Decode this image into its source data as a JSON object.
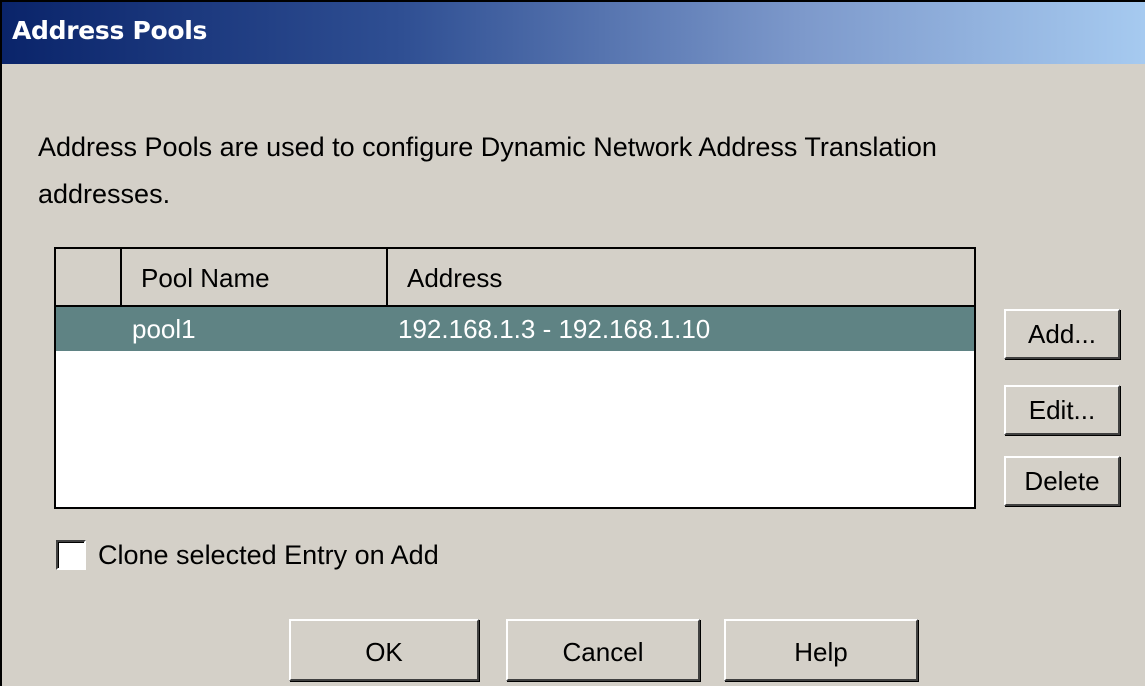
{
  "window": {
    "title": "Address Pools"
  },
  "description": {
    "line1": "Address Pools are used to configure Dynamic Network Address Translation",
    "line2": "addresses."
  },
  "table": {
    "columns": [
      "",
      "Pool Name",
      "Address"
    ],
    "rows": [
      {
        "selected": true,
        "pool_name": "pool1",
        "address": "192.168.1.3 - 192.168.1.10"
      }
    ],
    "selected_row_color": "#5f8384"
  },
  "side_buttons": {
    "add": "Add...",
    "edit": "Edit...",
    "delete": "Delete"
  },
  "clone_checkbox": {
    "label": "Clone selected Entry on Add",
    "checked": false
  },
  "footer_buttons": {
    "ok": "OK",
    "cancel": "Cancel",
    "help": "Help"
  },
  "colors": {
    "title_gradient_start": "#0a246a",
    "title_gradient_end": "#a6caf0",
    "dialog_background": "#d4d0c8"
  }
}
